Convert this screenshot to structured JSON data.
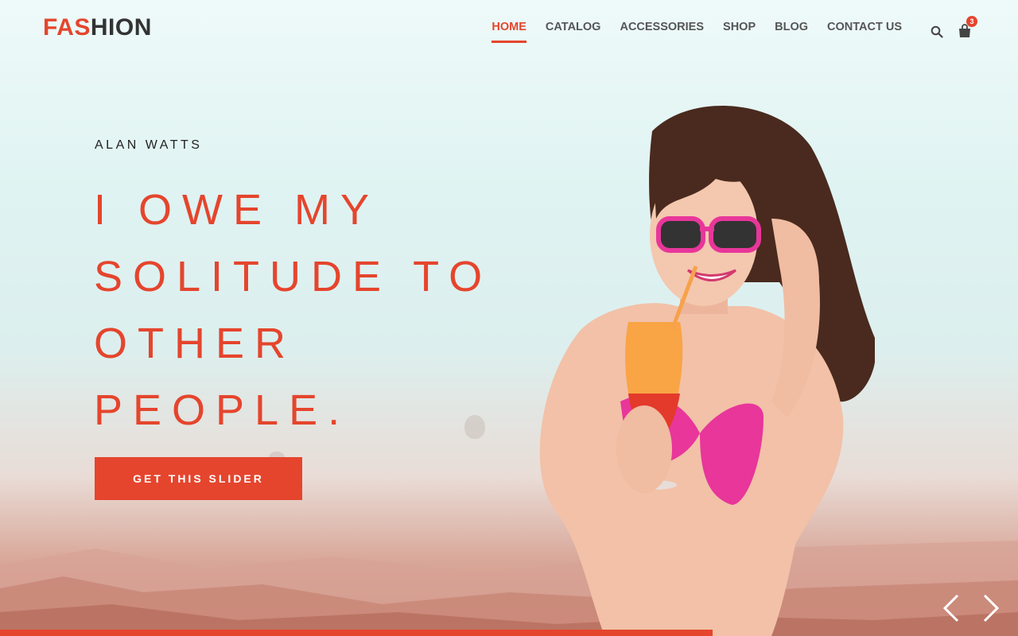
{
  "brand": {
    "logo_accent": "FAS",
    "logo_rest": "HION",
    "accent_color": "#e5452d"
  },
  "nav": {
    "items": [
      {
        "label": "HOME",
        "active": true
      },
      {
        "label": "CATALOG",
        "active": false
      },
      {
        "label": "ACCESSORIES",
        "active": false
      },
      {
        "label": "SHOP",
        "active": false
      },
      {
        "label": "BLOG",
        "active": false
      },
      {
        "label": "CONTACT US",
        "active": false
      }
    ],
    "search_icon": "search-icon",
    "cart_icon": "shopping-bag-icon",
    "cart_count": "3"
  },
  "hero": {
    "author": "ALAN WATTS",
    "headline_lines": [
      "I OWE MY",
      "SOLITUDE TO",
      "OTHER",
      "PEOPLE."
    ],
    "cta_label": "GET THIS SLIDER"
  },
  "slider": {
    "prev_icon": "chevron-left-icon",
    "next_icon": "chevron-right-icon",
    "progress": 0.7
  }
}
